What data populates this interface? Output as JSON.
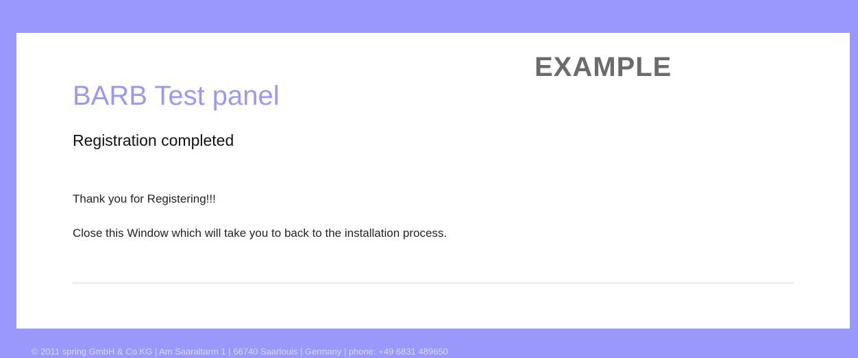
{
  "watermark": "EXAMPLE",
  "panel": {
    "title": "BARB Test panel",
    "subtitle": "Registration completed",
    "thank_you": "Thank you for Registering!!!",
    "instruction": "Close this Window which will take you to back to the installation process."
  },
  "footer": {
    "text": "© 2011 spring GmbH & Co.KG | Am Saaraltarm 1 | 66740 Saarlouis | Germany | phone: +49 6831 489650"
  },
  "colors": {
    "frame_background": "#9a98fb",
    "panel_background": "#ffffff",
    "title": "#9a98f2",
    "watermark": "#6b6b6b"
  }
}
